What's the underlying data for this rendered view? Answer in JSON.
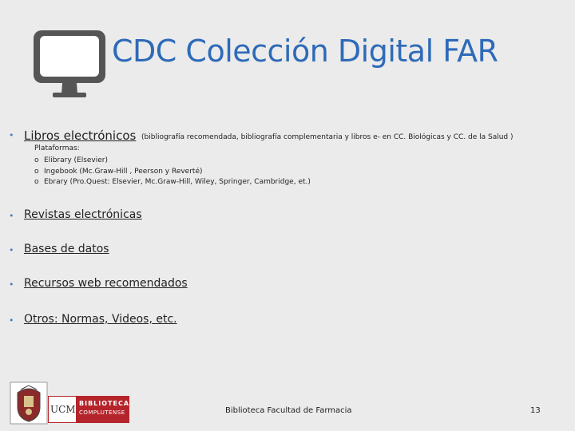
{
  "header": {
    "title": "CDC Colección Digital FAR",
    "icon": "monitor-icon"
  },
  "items": [
    {
      "bullet": "•",
      "label": "Libros electrónicos",
      "note": "(bibliografía recomendada, bibliografía complementaria y  libros e- en CC. Biológicas y CC. de la Salud )",
      "platforms_label": "Plataformas:",
      "platforms": [
        {
          "marker": "o",
          "text": "Elibrary (Elsevier)"
        },
        {
          "marker": "o",
          "text": "Ingebook (Mc.Graw-Hill , Peerson y Reverté)"
        },
        {
          "marker": "o",
          "text": "Ebrary (Pro.Quest: Elsevier, Mc.Graw-Hill, Wiley, Springer, Cambridge, et.)"
        }
      ]
    },
    {
      "bullet": "•",
      "label": "Revistas electrónicas"
    },
    {
      "bullet": "•",
      "label": "Bases de datos"
    },
    {
      "bullet": "•",
      "label": "Recursos web recomendados"
    },
    {
      "bullet": "•",
      "label": "Otros: Normas, Videos, etc."
    }
  ],
  "footer": {
    "logo_ucm": "UCM crest logo",
    "logo_library_ucm": "UCM",
    "logo_library_line1": "BIBLIOTECA",
    "logo_library_line2": "COMPLUTENSE",
    "text": "Biblioteca Facultad de Farmacia",
    "page_number": "13"
  },
  "colors": {
    "title": "#2e6ab8",
    "background": "#ebebeb",
    "bullet": "#4a80c0",
    "library_red": "#b5242b"
  }
}
